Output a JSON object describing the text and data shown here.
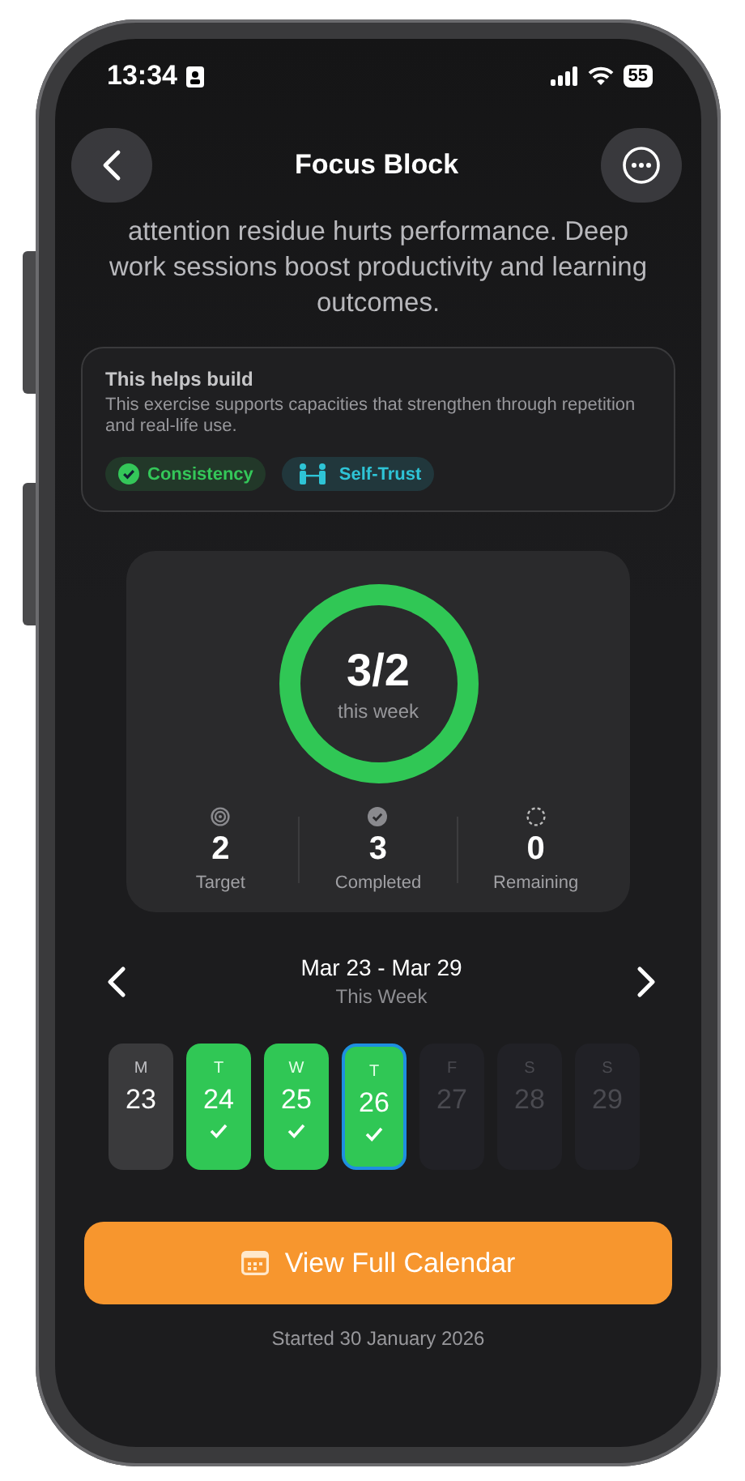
{
  "status_bar": {
    "time": "13:34",
    "battery": "55"
  },
  "header": {
    "title": "Focus Block"
  },
  "intro": "attention residue hurts performance. Deep work sessions boost productivity and learning outcomes.",
  "helps_card": {
    "title": "This helps build",
    "description": "This exercise supports capacities that strengthen through repetition and real-life use.",
    "tags": [
      {
        "label": "Consistency",
        "kind": "check",
        "color": "#34c759"
      },
      {
        "label": "Self-Trust",
        "kind": "people",
        "color": "#2ec4d6"
      }
    ]
  },
  "progress": {
    "value": "3/2",
    "caption": "this week",
    "level": 1,
    "stats": [
      {
        "kind": "target",
        "value": "2",
        "label": "Target"
      },
      {
        "kind": "completed",
        "value": "3",
        "label": "Completed"
      },
      {
        "kind": "remaining",
        "value": "0",
        "label": "Remaining"
      }
    ]
  },
  "week": {
    "range": "Mar 23 - Mar 29",
    "caption": "This Week",
    "days": [
      {
        "letter": "M",
        "date": "23",
        "completed": false,
        "future": false,
        "selected": false
      },
      {
        "letter": "T",
        "date": "24",
        "completed": true,
        "future": false,
        "selected": false
      },
      {
        "letter": "W",
        "date": "25",
        "completed": true,
        "future": false,
        "selected": false
      },
      {
        "letter": "T",
        "date": "26",
        "completed": true,
        "future": false,
        "selected": true
      },
      {
        "letter": "F",
        "date": "27",
        "completed": false,
        "future": true,
        "selected": false
      },
      {
        "letter": "S",
        "date": "28",
        "completed": false,
        "future": true,
        "selected": false
      },
      {
        "letter": "S",
        "date": "29",
        "completed": false,
        "future": true,
        "selected": false
      }
    ]
  },
  "calendar_button": {
    "label": "View Full Calendar"
  },
  "footer": "Started 30 January 2026"
}
